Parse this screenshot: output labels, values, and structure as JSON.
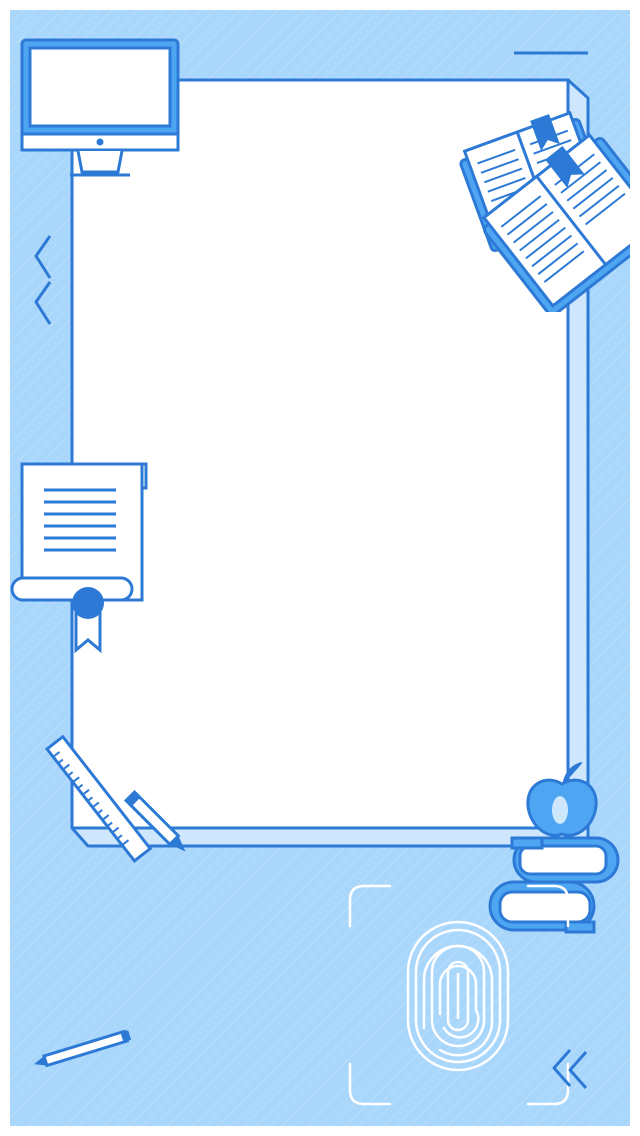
{
  "palette": {
    "background": "#a9d6fb",
    "stroke": "#2d7ad6",
    "fill_light": "#ffffff",
    "fill_mid": "#cfe7fc",
    "fill_accent": "#4ea6f3"
  },
  "decorations": {
    "monitor": "monitor-icon",
    "books": "open-books-icon",
    "zigzag": "zigzag-icon",
    "certificate": "diploma-scroll-icon",
    "ruler": "ruler-icon",
    "pencil": "pencil-icon",
    "apple": "apple-icon",
    "book_stack": "book-stack-icon",
    "fingerprint": "fingerprint-icon",
    "scanner": "scan-frame-icon"
  }
}
